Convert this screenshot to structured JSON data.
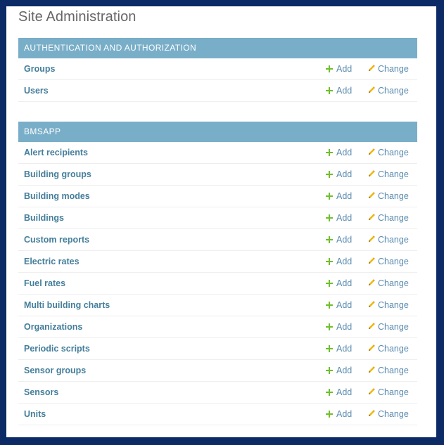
{
  "page": {
    "title": "Site Administration",
    "accent_color": "#79aec8",
    "link_color": "#447e9b",
    "add_icon": "plus-icon",
    "change_icon": "pencil-icon"
  },
  "modules": [
    {
      "caption": "AUTHENTICATION AND AUTHORIZATION",
      "models": [
        {
          "name": "Groups",
          "add_label": "Add",
          "change_label": "Change"
        },
        {
          "name": "Users",
          "add_label": "Add",
          "change_label": "Change"
        }
      ]
    },
    {
      "caption": "BMSAPP",
      "models": [
        {
          "name": "Alert recipients",
          "add_label": "Add",
          "change_label": "Change"
        },
        {
          "name": "Building groups",
          "add_label": "Add",
          "change_label": "Change"
        },
        {
          "name": "Building modes",
          "add_label": "Add",
          "change_label": "Change"
        },
        {
          "name": "Buildings",
          "add_label": "Add",
          "change_label": "Change"
        },
        {
          "name": "Custom reports",
          "add_label": "Add",
          "change_label": "Change"
        },
        {
          "name": "Electric rates",
          "add_label": "Add",
          "change_label": "Change"
        },
        {
          "name": "Fuel rates",
          "add_label": "Add",
          "change_label": "Change"
        },
        {
          "name": "Multi building charts",
          "add_label": "Add",
          "change_label": "Change"
        },
        {
          "name": "Organizations",
          "add_label": "Add",
          "change_label": "Change"
        },
        {
          "name": "Periodic scripts",
          "add_label": "Add",
          "change_label": "Change"
        },
        {
          "name": "Sensor groups",
          "add_label": "Add",
          "change_label": "Change"
        },
        {
          "name": "Sensors",
          "add_label": "Add",
          "change_label": "Change"
        },
        {
          "name": "Units",
          "add_label": "Add",
          "change_label": "Change"
        }
      ]
    }
  ]
}
